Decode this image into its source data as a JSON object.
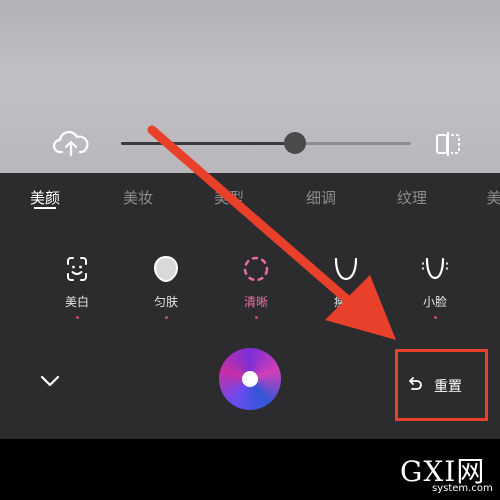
{
  "preview": {
    "slider_percent": 60
  },
  "tabs": [
    {
      "label": "美颜",
      "active": true
    },
    {
      "label": "美妆",
      "active": false
    },
    {
      "label": "美型",
      "active": false
    },
    {
      "label": "细调",
      "active": false
    },
    {
      "label": "纹理",
      "active": false
    },
    {
      "label": "美",
      "active": false
    }
  ],
  "tools": [
    {
      "label": "美白",
      "icon": "face-icon",
      "active": false
    },
    {
      "label": "匀肤",
      "icon": "skin-icon",
      "active": false
    },
    {
      "label": "清晰",
      "icon": "clarity-icon",
      "active": true
    },
    {
      "label": "瘦脸",
      "icon": "face-shape-icon",
      "active": false
    },
    {
      "label": "小脸",
      "icon": "small-face-icon",
      "active": false
    }
  ],
  "bottom": {
    "reset_label": "重置"
  },
  "watermark": {
    "main": "GXI网",
    "sub": "system.com"
  },
  "colors": {
    "accent": "#e8709c",
    "annotation": "#e8402a",
    "panel": "#2c2c2e"
  }
}
